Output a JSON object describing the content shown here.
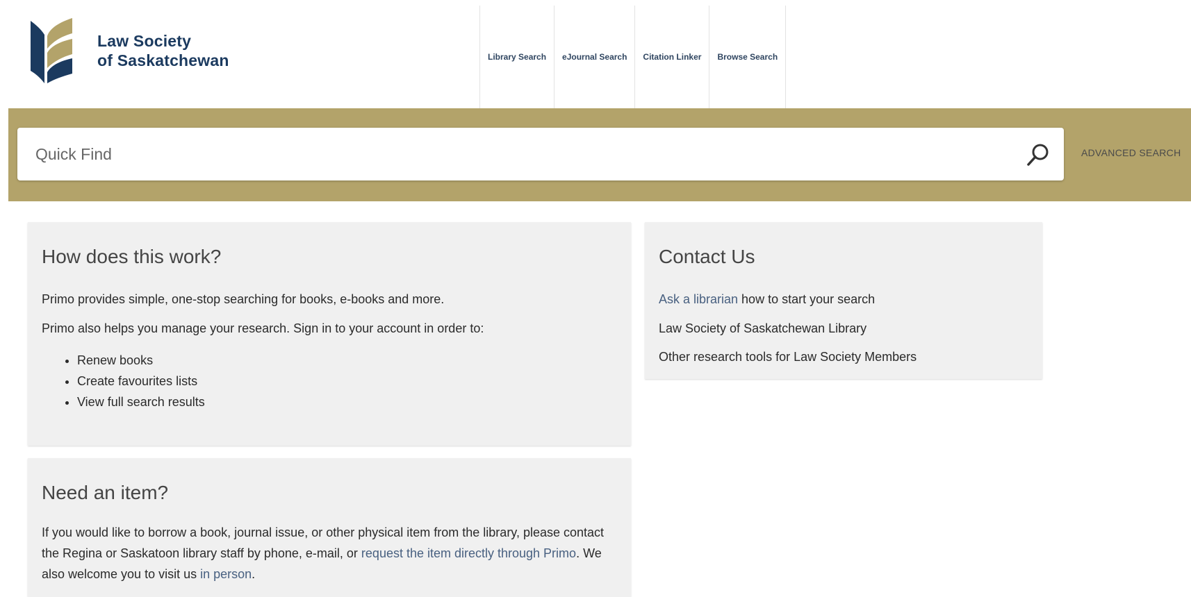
{
  "brand": {
    "line1": "Law Society",
    "line2": "of Saskatchewan",
    "colors": {
      "navy": "#1b3a5f",
      "gold": "#b3a36a"
    }
  },
  "nav": {
    "items": [
      {
        "label": "Library Search"
      },
      {
        "label": "eJournal Search"
      },
      {
        "label": "Citation Linker"
      },
      {
        "label": "Browse Search"
      }
    ]
  },
  "search": {
    "placeholder": "Quick Find",
    "icon": "search-icon",
    "advanced_label": "ADVANCED SEARCH"
  },
  "how": {
    "title": "How does this work?",
    "p1": "Primo provides simple, one-stop searching for books, e-books and more.",
    "p2": "Primo also helps you manage your research. Sign in to your account in order to:",
    "bullets": [
      "Renew books",
      "Create favourites lists",
      "View full search results"
    ]
  },
  "need": {
    "title": "Need an item?",
    "text_before": "If you would like to borrow a book, journal issue, or other physical item from the library, please contact the Regina or Saskatoon library staff by phone, e-mail, or ",
    "link_request": "request the item directly through Primo",
    "text_middle": ". We also welcome you to visit us ",
    "link_visit": "in person",
    "text_after": "."
  },
  "contact": {
    "title": "Contact Us",
    "ask_link": "Ask a librarian",
    "ask_rest": " how to start your search",
    "library_link": "Law Society of Saskatchewan Library",
    "other_link": "Other research tools for Law Society Members"
  }
}
